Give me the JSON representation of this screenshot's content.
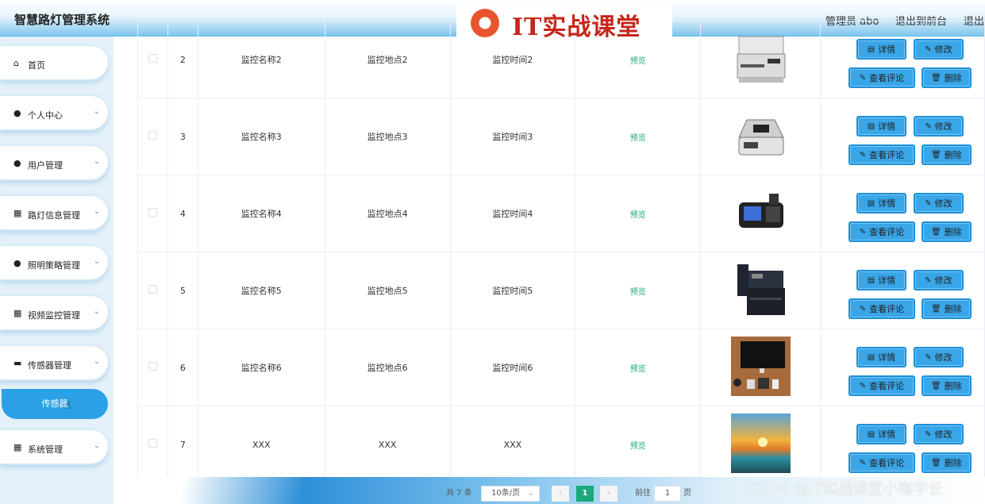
{
  "header": {
    "title": "智慧路灯管理系统",
    "logo_text": "IT实战课堂",
    "admin_label": "管理员 abo",
    "goto_front": "退出到前台",
    "logout": "退出"
  },
  "sidebar": {
    "items": [
      {
        "label": "首页",
        "icon": "home-icon"
      },
      {
        "label": "个人中心",
        "icon": "user-icon"
      },
      {
        "label": "用户管理",
        "icon": "location-icon"
      },
      {
        "label": "路灯信息管理",
        "icon": "grid-icon"
      },
      {
        "label": "照明策略管理",
        "icon": "user-icon"
      },
      {
        "label": "视频监控管理",
        "icon": "grid-icon"
      },
      {
        "label": "传感器管理",
        "icon": "monitor-icon"
      },
      {
        "label": "系统管理",
        "icon": "grid-icon"
      }
    ],
    "active_sub": "传感器"
  },
  "table": {
    "rows": [
      {
        "index": "2",
        "name": "监控名称2",
        "location": "监控地点2",
        "time": "监控时间2",
        "preview": "预览",
        "image": "printer"
      },
      {
        "index": "3",
        "name": "监控名称3",
        "location": "监控地点3",
        "time": "监控时间3",
        "preview": "预览",
        "image": "money-counter"
      },
      {
        "index": "4",
        "name": "监控名称4",
        "location": "监控地点4",
        "time": "监控时间4",
        "preview": "预览",
        "image": "card-terminal"
      },
      {
        "index": "5",
        "name": "监控名称5",
        "location": "监控地点5",
        "time": "监控时间5",
        "preview": "预览",
        "image": "copier"
      },
      {
        "index": "6",
        "name": "监控名称6",
        "location": "监控地点6",
        "time": "监控时间6",
        "preview": "预览",
        "image": "desk-monitor"
      },
      {
        "index": "7",
        "name": "XXX",
        "location": "XXX",
        "time": "XXX",
        "preview": "预览",
        "image": "seascape"
      }
    ],
    "actions": {
      "detail": "详情",
      "edit": "修改",
      "comments": "查看评论",
      "delete": "删除"
    }
  },
  "pagination": {
    "total": "共 7 条",
    "page_size": "10条/页",
    "current_page": "1",
    "goto_label": "前往",
    "goto_value": "1",
    "page_unit": "页"
  },
  "watermark": "CSDN @IT实战课堂小咖学长"
}
